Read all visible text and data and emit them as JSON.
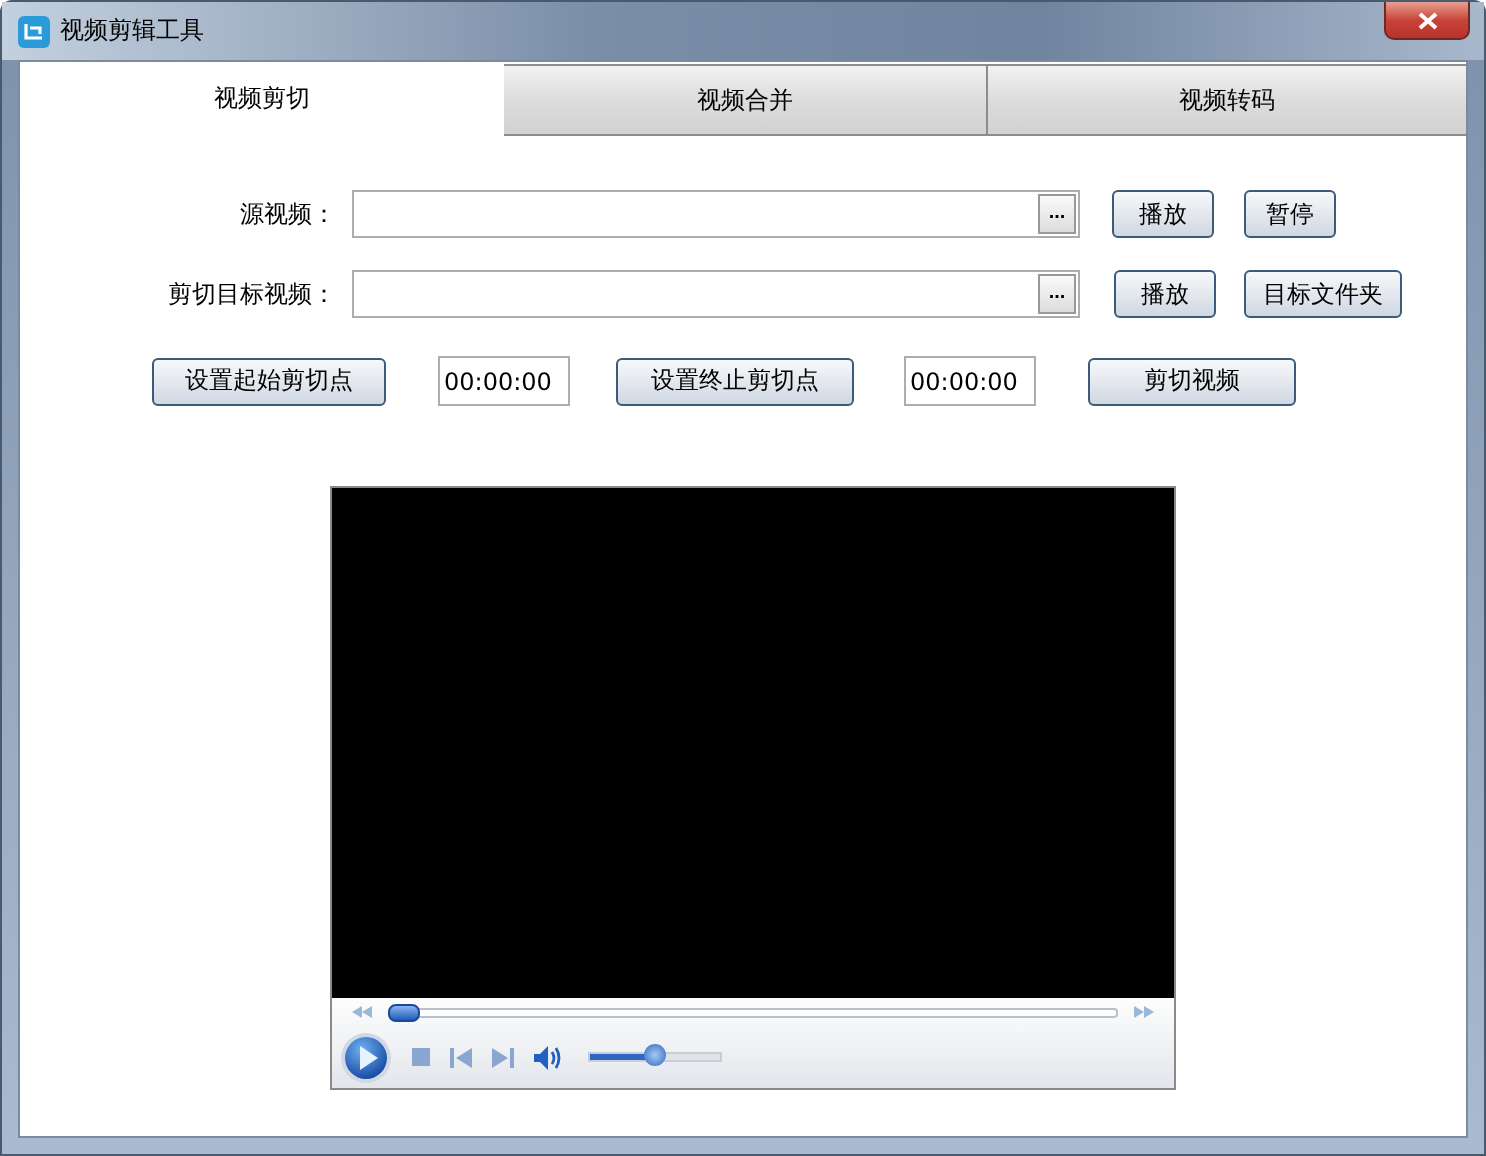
{
  "window": {
    "title": "视频剪辑工具"
  },
  "tabs": [
    {
      "label": "视频剪切",
      "selected": true
    },
    {
      "label": "视频合并",
      "selected": false
    },
    {
      "label": "视频转码",
      "selected": false
    }
  ],
  "file_rows": [
    {
      "label": "源视频：",
      "browse": "...",
      "buttons": [
        "播放",
        "暂停"
      ]
    },
    {
      "label": "剪切目标视频：",
      "browse": "...",
      "buttons": [
        "播放",
        "目标文件夹"
      ]
    }
  ],
  "cut_row": [
    {
      "kind": "button",
      "text": "设置起始剪切点"
    },
    {
      "kind": "field",
      "value": "00:00:00"
    },
    {
      "kind": "button",
      "text": "设置终止剪切点"
    },
    {
      "kind": "field",
      "value": "00:00:00"
    },
    {
      "kind": "button",
      "text": "剪切视频"
    }
  ],
  "player": {
    "seek": {
      "level": 0.02
    },
    "volume": {
      "level": 0.5
    }
  }
}
